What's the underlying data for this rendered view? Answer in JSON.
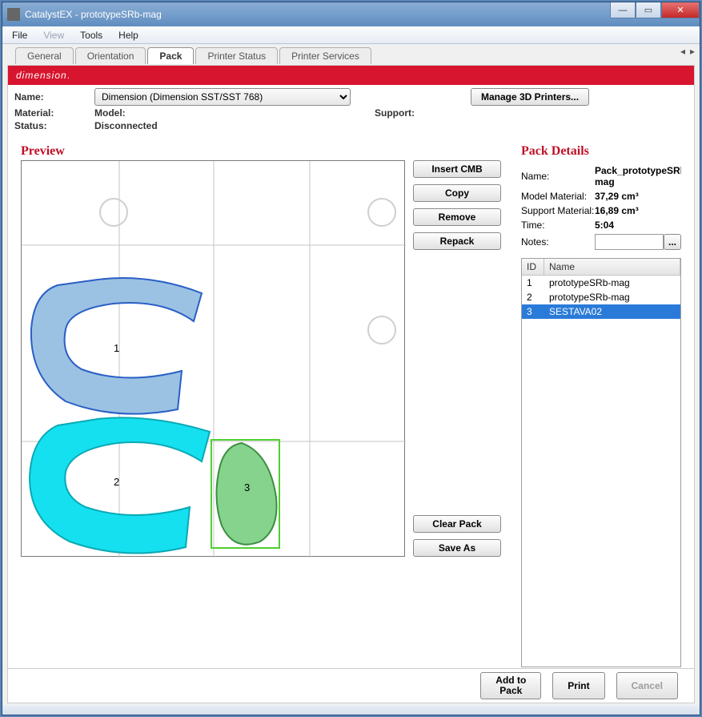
{
  "window": {
    "title": "CatalystEX - prototypeSRb-mag"
  },
  "menu": {
    "file": "File",
    "view": "View",
    "tools": "Tools",
    "help": "Help"
  },
  "tabs": {
    "items": [
      "General",
      "Orientation",
      "Pack",
      "Printer Status",
      "Printer Services"
    ],
    "active": "Pack"
  },
  "brand": "dimension",
  "info": {
    "name_label": "Name:",
    "printer_selected": "Dimension  (Dimension SST/SST 768)",
    "manage_btn": "Manage 3D Printers...",
    "material_label": "Material:",
    "model_label": "Model:",
    "support_label": "Support:",
    "status_label": "Status:",
    "status_value": "Disconnected"
  },
  "preview": {
    "title": "Preview",
    "insert_cmb": "Insert CMB",
    "copy": "Copy",
    "remove": "Remove",
    "repack": "Repack",
    "clear_pack": "Clear Pack",
    "save_as": "Save As",
    "parts": [
      {
        "id": "1",
        "selected": false
      },
      {
        "id": "2",
        "selected": false
      },
      {
        "id": "3",
        "selected": true
      }
    ]
  },
  "packdetails": {
    "title": "Pack Details",
    "name_label": "Name:",
    "name_value": "Pack_prototypeSRb-mag",
    "model_mat_label": "Model Material:",
    "model_mat_value": "37,29 cm³",
    "support_mat_label": "Support Material:",
    "support_mat_value": "16,89 cm³",
    "time_label": "Time:",
    "time_value": "5:04",
    "notes_label": "Notes:",
    "notes_value": "",
    "notes_btn": "...",
    "list_id": "ID",
    "list_name": "Name",
    "items": [
      {
        "id": "1",
        "name": "prototypeSRb-mag",
        "selected": false
      },
      {
        "id": "2",
        "name": "prototypeSRb-mag",
        "selected": false
      },
      {
        "id": "3",
        "name": "SESTAVA02",
        "selected": true
      }
    ]
  },
  "footer": {
    "add_to_pack_l1": "Add to",
    "add_to_pack_l2": "Pack",
    "print": "Print",
    "cancel": "Cancel"
  }
}
